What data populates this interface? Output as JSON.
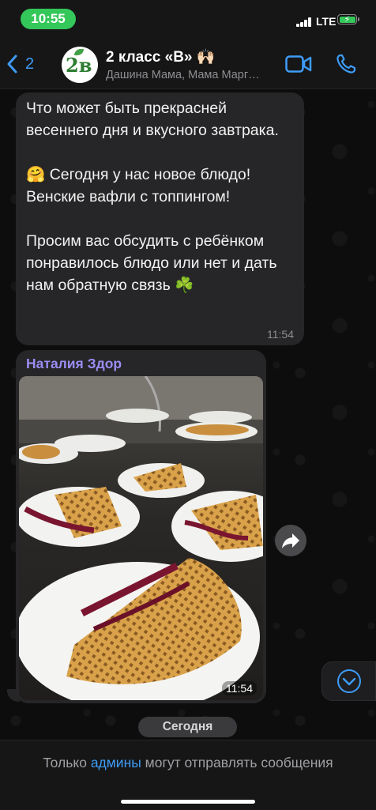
{
  "status_bar": {
    "time": "10:55",
    "network": "LTE"
  },
  "header": {
    "back_count": "2",
    "avatar_text": "2в",
    "title": "2 класс «В» 🙌🏻",
    "subtitle": "Дашина Мама, Мама Марг…"
  },
  "messages": [
    {
      "text": "Что может быть прекрасней весеннего дня и вкусного завтрака.\n\n🤗 Сегодня у нас новое блюдо! Венские вафли с топпингом!\n\nПросим вас обсудить с ребёнком понравилось блюдо или нет и дать нам обратную связь ☘️",
      "time": "11:54"
    },
    {
      "sender": "Наталия Здор",
      "photo_time": "11:54"
    }
  ],
  "date_chip": "Сегодня",
  "footer": {
    "before": "Только ",
    "link": "админы",
    "after": " могут отправлять сообщения"
  },
  "colors": {
    "accent": "#3e9cf7",
    "bubble": "#262628",
    "sender": "#9a8df2",
    "time_pill": "#34c759"
  },
  "icons": [
    "chevron-left-icon",
    "video-call-icon",
    "phone-icon",
    "forward-icon",
    "chevron-down-icon",
    "signal-icon",
    "battery-icon"
  ]
}
